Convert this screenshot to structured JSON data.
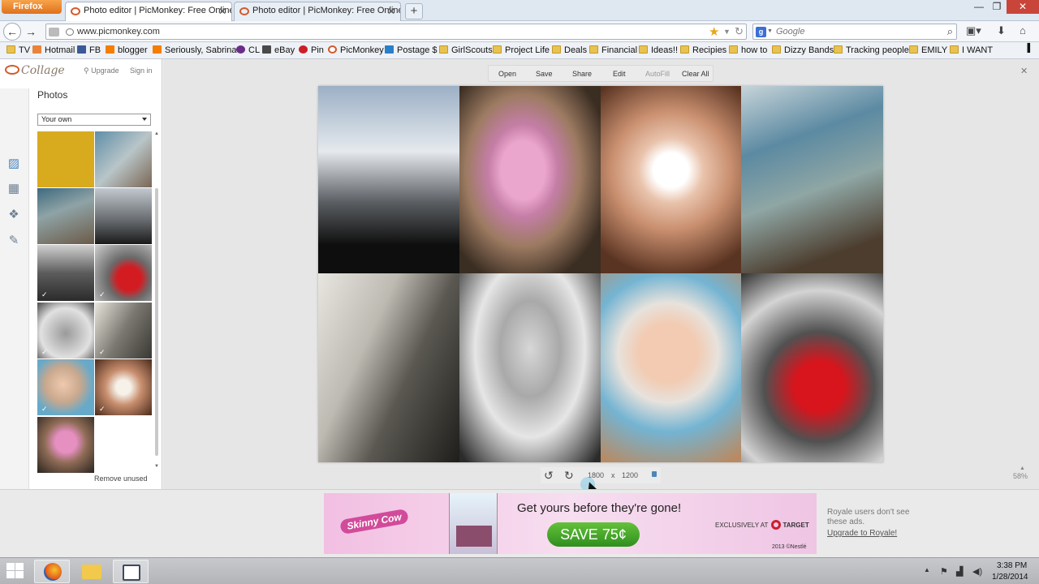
{
  "browser": {
    "app_button": "Firefox",
    "tabs": [
      {
        "title": "Photo editor | PicMonkey: Free Online...",
        "active": true
      },
      {
        "title": "Photo editor | PicMonkey: Free Online...",
        "active": false
      }
    ],
    "new_tab": "+",
    "window_controls": {
      "minimize": "—",
      "maximize": "❐",
      "close": "✕"
    },
    "url": "www.picmonkey.com",
    "search_engine": "Google",
    "search_placeholder": "Google"
  },
  "bookmarks": [
    {
      "label": "TV",
      "icon": "folder"
    },
    {
      "label": "Hotmail",
      "icon": "hotmail"
    },
    {
      "label": "FB",
      "icon": "facebook"
    },
    {
      "label": "blogger",
      "icon": "blogger"
    },
    {
      "label": "Seriously, Sabrina?",
      "icon": "blogger"
    },
    {
      "label": "CL",
      "icon": "peace"
    },
    {
      "label": "eBay",
      "icon": "ebay"
    },
    {
      "label": "Pin",
      "icon": "pinterest"
    },
    {
      "label": "PicMonkey",
      "icon": "picmonkey"
    },
    {
      "label": "Postage $",
      "icon": "postage"
    },
    {
      "label": "GirlScouts",
      "icon": "folder"
    },
    {
      "label": "Project Life",
      "icon": "folder"
    },
    {
      "label": "Deals",
      "icon": "folder"
    },
    {
      "label": "Financial",
      "icon": "folder"
    },
    {
      "label": "Ideas!!",
      "icon": "folder"
    },
    {
      "label": "Recipies",
      "icon": "folder"
    },
    {
      "label": "how to",
      "icon": "folder"
    },
    {
      "label": "Dizzy Bands",
      "icon": "folder"
    },
    {
      "label": "Tracking people",
      "icon": "folder"
    },
    {
      "label": "EMILY",
      "icon": "folder"
    },
    {
      "label": "I WANT",
      "icon": "folder"
    }
  ],
  "app": {
    "logo": "Collage",
    "upgrade": "Upgrade",
    "signin": "Sign in",
    "panel_title": "Photos",
    "source_select": "Your own",
    "remove_unused": "Remove unused",
    "toolbar": {
      "open": "Open",
      "save": "Save",
      "share": "Share",
      "edit": "Edit",
      "autofill": "AutoFill",
      "clear_all": "Clear All"
    },
    "dimensions": {
      "width": "1800",
      "separator": "x",
      "height": "1200"
    },
    "zoom": "58%"
  },
  "ad": {
    "brand": "Skinny Cow",
    "headline": "Get yours before they're gone!",
    "cta": "SAVE 75¢",
    "exclusive": "EXCLUSIVELY AT",
    "retailer": "TARGET",
    "legal": "2013 ©Nestlé"
  },
  "royale": {
    "note": "Royale users don't see these ads.",
    "link": "Upgrade to Royale!"
  },
  "taskbar": {
    "time": "3:38 PM",
    "date": "1/28/2014"
  }
}
